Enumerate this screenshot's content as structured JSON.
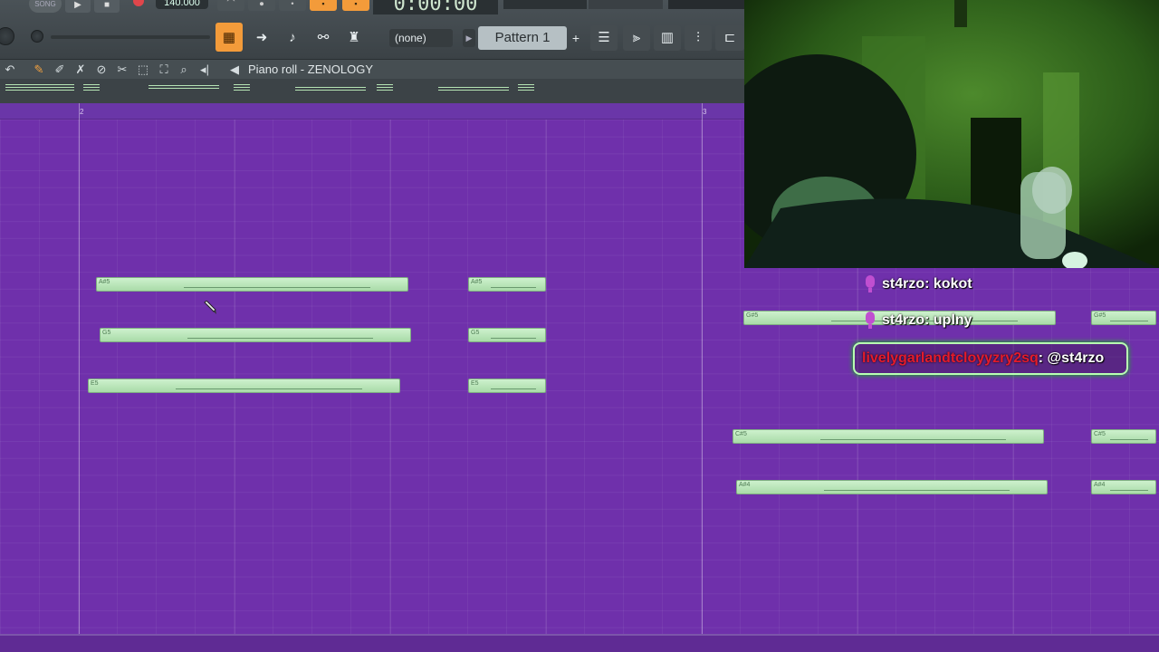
{
  "toolbar": {
    "song_mode_label": "SONG",
    "tempo_value": "140.000",
    "time_display": "0:00:00",
    "pattern_selector_value": "(none)",
    "pattern_name": "Pattern 1",
    "pattern_add_label": "+"
  },
  "piano_roll": {
    "title": "Piano roll - ZENOLOGY",
    "bar_numbers": [
      "2",
      "3"
    ]
  },
  "notes": [
    {
      "label": "A#5"
    },
    {
      "label": "A#5"
    },
    {
      "label": "G5"
    },
    {
      "label": "G5"
    },
    {
      "label": "E5"
    },
    {
      "label": "E5"
    },
    {
      "label": "G#5"
    },
    {
      "label": "G#5"
    },
    {
      "label": "C#5"
    },
    {
      "label": "C#5"
    },
    {
      "label": "A#4"
    },
    {
      "label": "A#4"
    }
  ],
  "chat": {
    "messages": [
      {
        "user": "st4rzo",
        "text": ": kokot"
      },
      {
        "user": "st4rzo",
        "text": ": uplny"
      }
    ],
    "highlight": {
      "user": "livelygarlandtcloyyzry2sq",
      "text": ": @st4rzo"
    }
  },
  "colors": {
    "grid_background": "#6f30ab",
    "note_fill": "#bfe9bf",
    "accent_orange": "#f39b3a",
    "chat_mic": "#c04fd0",
    "highlight_user": "#e41b2b"
  },
  "icons": {
    "toolbar": [
      "play-icon",
      "stop-icon",
      "record-icon",
      "piano-roll-icon",
      "arrow-right-icon",
      "pencil-icon",
      "link-icon",
      "stamp-icon",
      "playlist-icon",
      "channel-rack-icon",
      "mixer-icon"
    ],
    "piano_roll_tools": [
      "undo-icon",
      "pencil-icon",
      "paint-icon",
      "delete-icon",
      "mute-icon",
      "slice-icon",
      "select-icon",
      "zoom-icon",
      "playback-icon",
      "speaker-icon"
    ]
  }
}
